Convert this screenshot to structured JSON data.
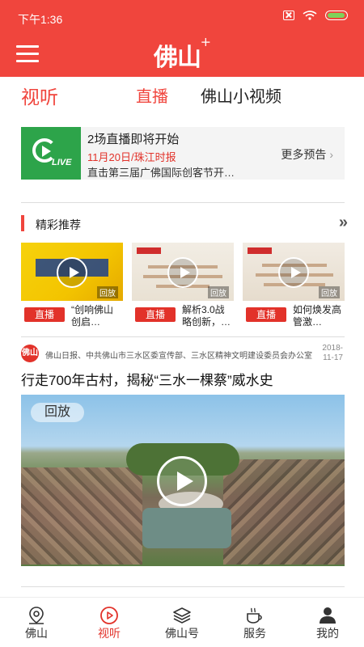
{
  "status_bar": {
    "time": "下午1:36"
  },
  "header": {
    "logo_text": "佛山",
    "logo_plus": "+"
  },
  "tabs": {
    "section_title": "视听",
    "live": "直播",
    "short_video": "佛山小视频"
  },
  "live_preview": {
    "logo_text": "LIVE",
    "headline": "2场直播即将开始",
    "schedule": "11月20日/珠江时报",
    "description": "直击第三届广佛国际创客节开…",
    "more_label": "更多预告",
    "more_chevron": "›"
  },
  "recommended": {
    "section_label": "精彩推荐",
    "more_icon": "»",
    "items": [
      {
        "live_label": "直播",
        "caption": "“创响佛山 创启…",
        "replay": "回放"
      },
      {
        "live_label": "直播",
        "caption": "解析3.0战略创新，…",
        "replay": "回放"
      },
      {
        "live_label": "直播",
        "caption": "如何焕发高管激…",
        "replay": "回放"
      }
    ]
  },
  "news": {
    "source_logo": "佛山",
    "source": "佛山日报、中共佛山市三水区委宣传部、三水区精神文明建设委员会办公室",
    "date": "2018-11-17",
    "title": "行走700年古村，揭秘“三水一棵蔡”威水史",
    "replay_label": "回放"
  },
  "bottom_nav": [
    {
      "label": "佛山",
      "icon": "location-pin-icon",
      "active": false
    },
    {
      "label": "视听",
      "icon": "play-circle-icon",
      "active": true
    },
    {
      "label": "佛山号",
      "icon": "layers-icon",
      "active": false
    },
    {
      "label": "服务",
      "icon": "coffee-cup-icon",
      "active": false
    },
    {
      "label": "我的",
      "icon": "person-icon",
      "active": false
    }
  ],
  "colors": {
    "brand_red": "#f0453d",
    "live_green": "#2da44a",
    "accent_red": "#e2322a"
  }
}
